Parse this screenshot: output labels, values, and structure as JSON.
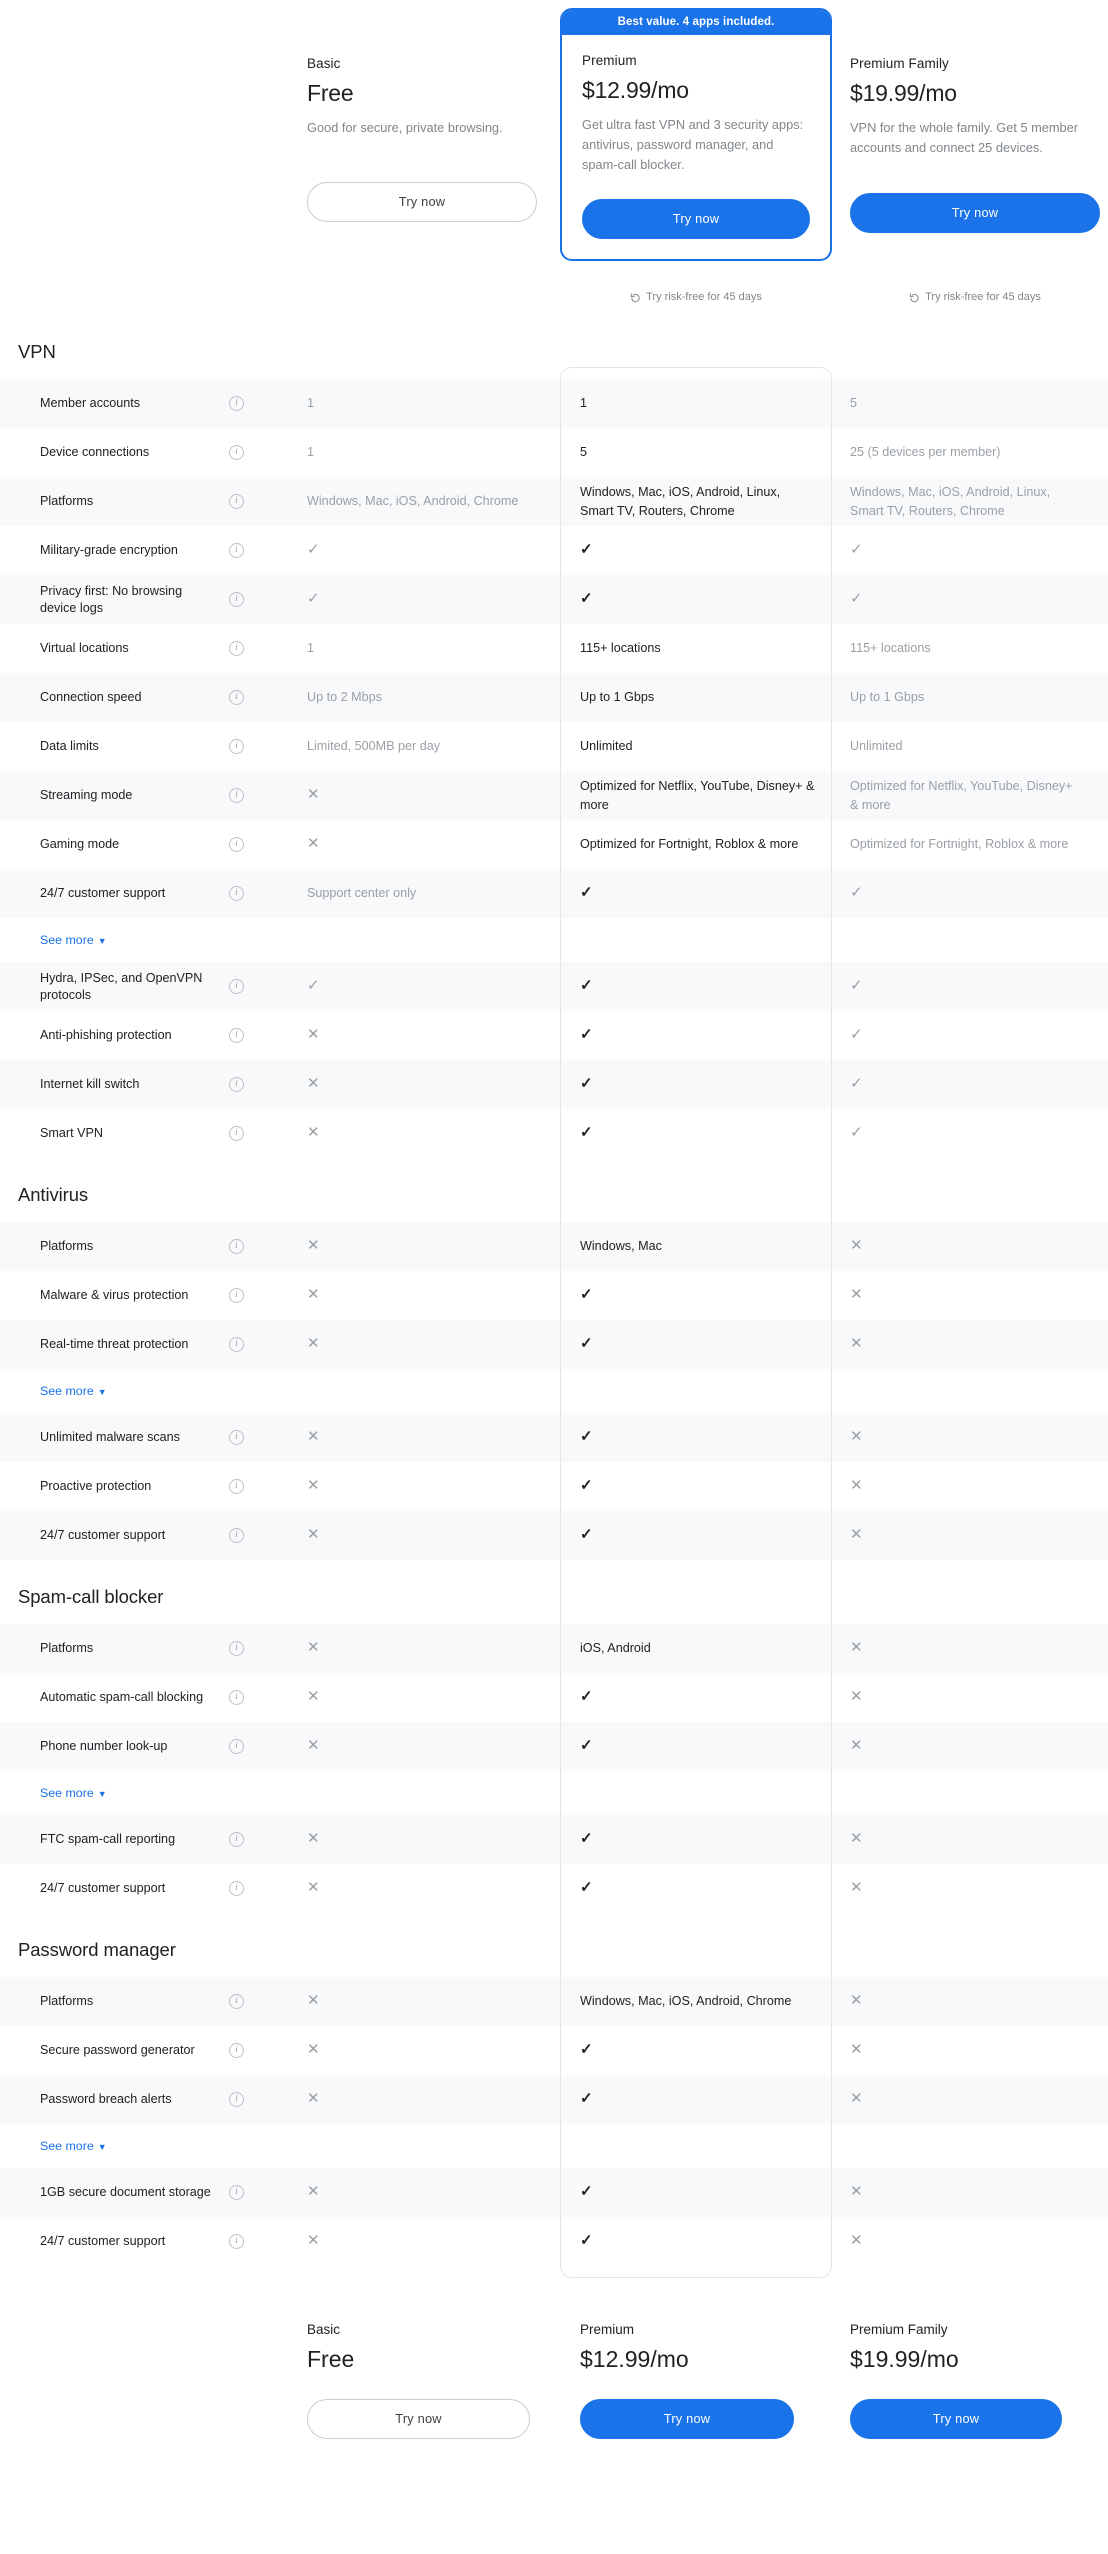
{
  "plans": {
    "basic": {
      "name": "Basic",
      "price": "Free",
      "desc": "Good for secure, private browsing.",
      "cta": "Try now"
    },
    "premium": {
      "badge": "Best value. 4 apps included.",
      "name": "Premium",
      "price": "$12.99/mo",
      "desc": "Get ultra fast VPN and 3 security apps: antivirus, password manager, and spam-call blocker.",
      "cta": "Try now",
      "riskfree": "Try risk-free for 45 days"
    },
    "family": {
      "name": "Premium Family",
      "price": "$19.99/mo",
      "desc": "VPN for the whole family. Get 5 member accounts and connect 25 devices.",
      "cta": "Try now",
      "riskfree": "Try risk-free for 45 days"
    }
  },
  "labels": {
    "see_more": "See more",
    "info": "i",
    "check": "✓",
    "cross": "✕"
  },
  "sections": [
    {
      "title": "VPN",
      "rows": [
        {
          "feature": "Member accounts",
          "basic": "1",
          "premium": "1",
          "family": "5"
        },
        {
          "feature": "Device connections",
          "basic": "1",
          "premium": "5",
          "family": "25 (5 devices per member)"
        },
        {
          "feature": "Platforms",
          "basic": "Windows, Mac, iOS, Android, Chrome",
          "premium": "Windows, Mac, iOS, Android, Linux, Smart TV, Routers, Chrome",
          "family": "Windows, Mac, iOS, Android, Linux, Smart TV, Routers, Chrome"
        },
        {
          "feature": "Military-grade encryption",
          "basic": "✓",
          "premium": "✓",
          "family": "✓"
        },
        {
          "feature": "Privacy first: No browsing device logs",
          "basic": "✓",
          "premium": "✓",
          "family": "✓"
        },
        {
          "feature": "Virtual locations",
          "basic": "1",
          "premium": "115+ locations",
          "family": "115+ locations"
        },
        {
          "feature": "Connection speed",
          "basic": "Up to 2 Mbps",
          "premium": "Up to 1 Gbps",
          "family": "Up to 1 Gbps"
        },
        {
          "feature": "Data limits",
          "basic": "Limited, 500MB per day",
          "premium": "Unlimited",
          "family": "Unlimited"
        },
        {
          "feature": "Streaming mode",
          "basic": "✕",
          "premium": "Optimized for Netflix, YouTube, Disney+ & more",
          "family": "Optimized for Netflix, YouTube, Disney+ & more"
        },
        {
          "feature": "Gaming mode",
          "basic": "✕",
          "premium": "Optimized for Fortnight, Roblox & more",
          "family": "Optimized for Fortnight, Roblox & more"
        },
        {
          "feature": "24/7 customer support",
          "basic": "Support center only",
          "premium": "✓",
          "family": "✓"
        }
      ],
      "see_more_after": 11,
      "rows_after": [
        {
          "feature": "Hydra, IPSec, and OpenVPN protocols",
          "basic": "✓",
          "premium": "✓",
          "family": "✓"
        },
        {
          "feature": "Anti-phishing protection",
          "basic": "✕",
          "premium": "✓",
          "family": "✓"
        },
        {
          "feature": "Internet kill switch",
          "basic": "✕",
          "premium": "✓",
          "family": "✓"
        },
        {
          "feature": "Smart VPN",
          "basic": "✕",
          "premium": "✓",
          "family": "✓"
        }
      ]
    },
    {
      "title": "Antivirus",
      "rows": [
        {
          "feature": "Platforms",
          "basic": "✕",
          "premium": "Windows, Mac",
          "family": "✕"
        },
        {
          "feature": "Malware & virus protection",
          "basic": "✕",
          "premium": "✓",
          "family": "✕"
        },
        {
          "feature": "Real-time threat protection",
          "basic": "✕",
          "premium": "✓",
          "family": "✕"
        }
      ],
      "see_more_after": 3,
      "rows_after": [
        {
          "feature": "Unlimited malware scans",
          "basic": "✕",
          "premium": "✓",
          "family": "✕"
        },
        {
          "feature": "Proactive protection",
          "basic": "✕",
          "premium": "✓",
          "family": "✕"
        },
        {
          "feature": "24/7 customer support",
          "basic": "✕",
          "premium": "✓",
          "family": "✕"
        }
      ]
    },
    {
      "title": "Spam-call blocker",
      "rows": [
        {
          "feature": "Platforms",
          "basic": "✕",
          "premium": "iOS, Android",
          "family": "✕"
        },
        {
          "feature": "Automatic spam-call blocking",
          "basic": "✕",
          "premium": "✓",
          "family": "✕"
        },
        {
          "feature": "Phone number look-up",
          "basic": "✕",
          "premium": "✓",
          "family": "✕"
        }
      ],
      "see_more_after": 3,
      "rows_after": [
        {
          "feature": "FTC spam-call reporting",
          "basic": "✕",
          "premium": "✓",
          "family": "✕"
        },
        {
          "feature": "24/7 customer support",
          "basic": "✕",
          "premium": "✓",
          "family": "✕"
        }
      ]
    },
    {
      "title": "Password manager",
      "rows": [
        {
          "feature": "Platforms",
          "basic": "✕",
          "premium": "Windows, Mac, iOS, Android, Chrome",
          "family": "✕"
        },
        {
          "feature": "Secure password generator",
          "basic": "✕",
          "premium": "✓",
          "family": "✕"
        },
        {
          "feature": "Password breach alerts",
          "basic": "✕",
          "premium": "✓",
          "family": "✕"
        }
      ],
      "see_more_after": 3,
      "rows_after": [
        {
          "feature": "1GB secure document storage",
          "basic": "✕",
          "premium": "✓",
          "family": "✕"
        },
        {
          "feature": "24/7 customer support",
          "basic": "✕",
          "premium": "✓",
          "family": "✕"
        }
      ]
    }
  ],
  "colors": {
    "accent": "#1a73e8",
    "row_shade": "#f8f9fa",
    "muted_text": "#9aa0a6",
    "primary_text": "#202124"
  }
}
